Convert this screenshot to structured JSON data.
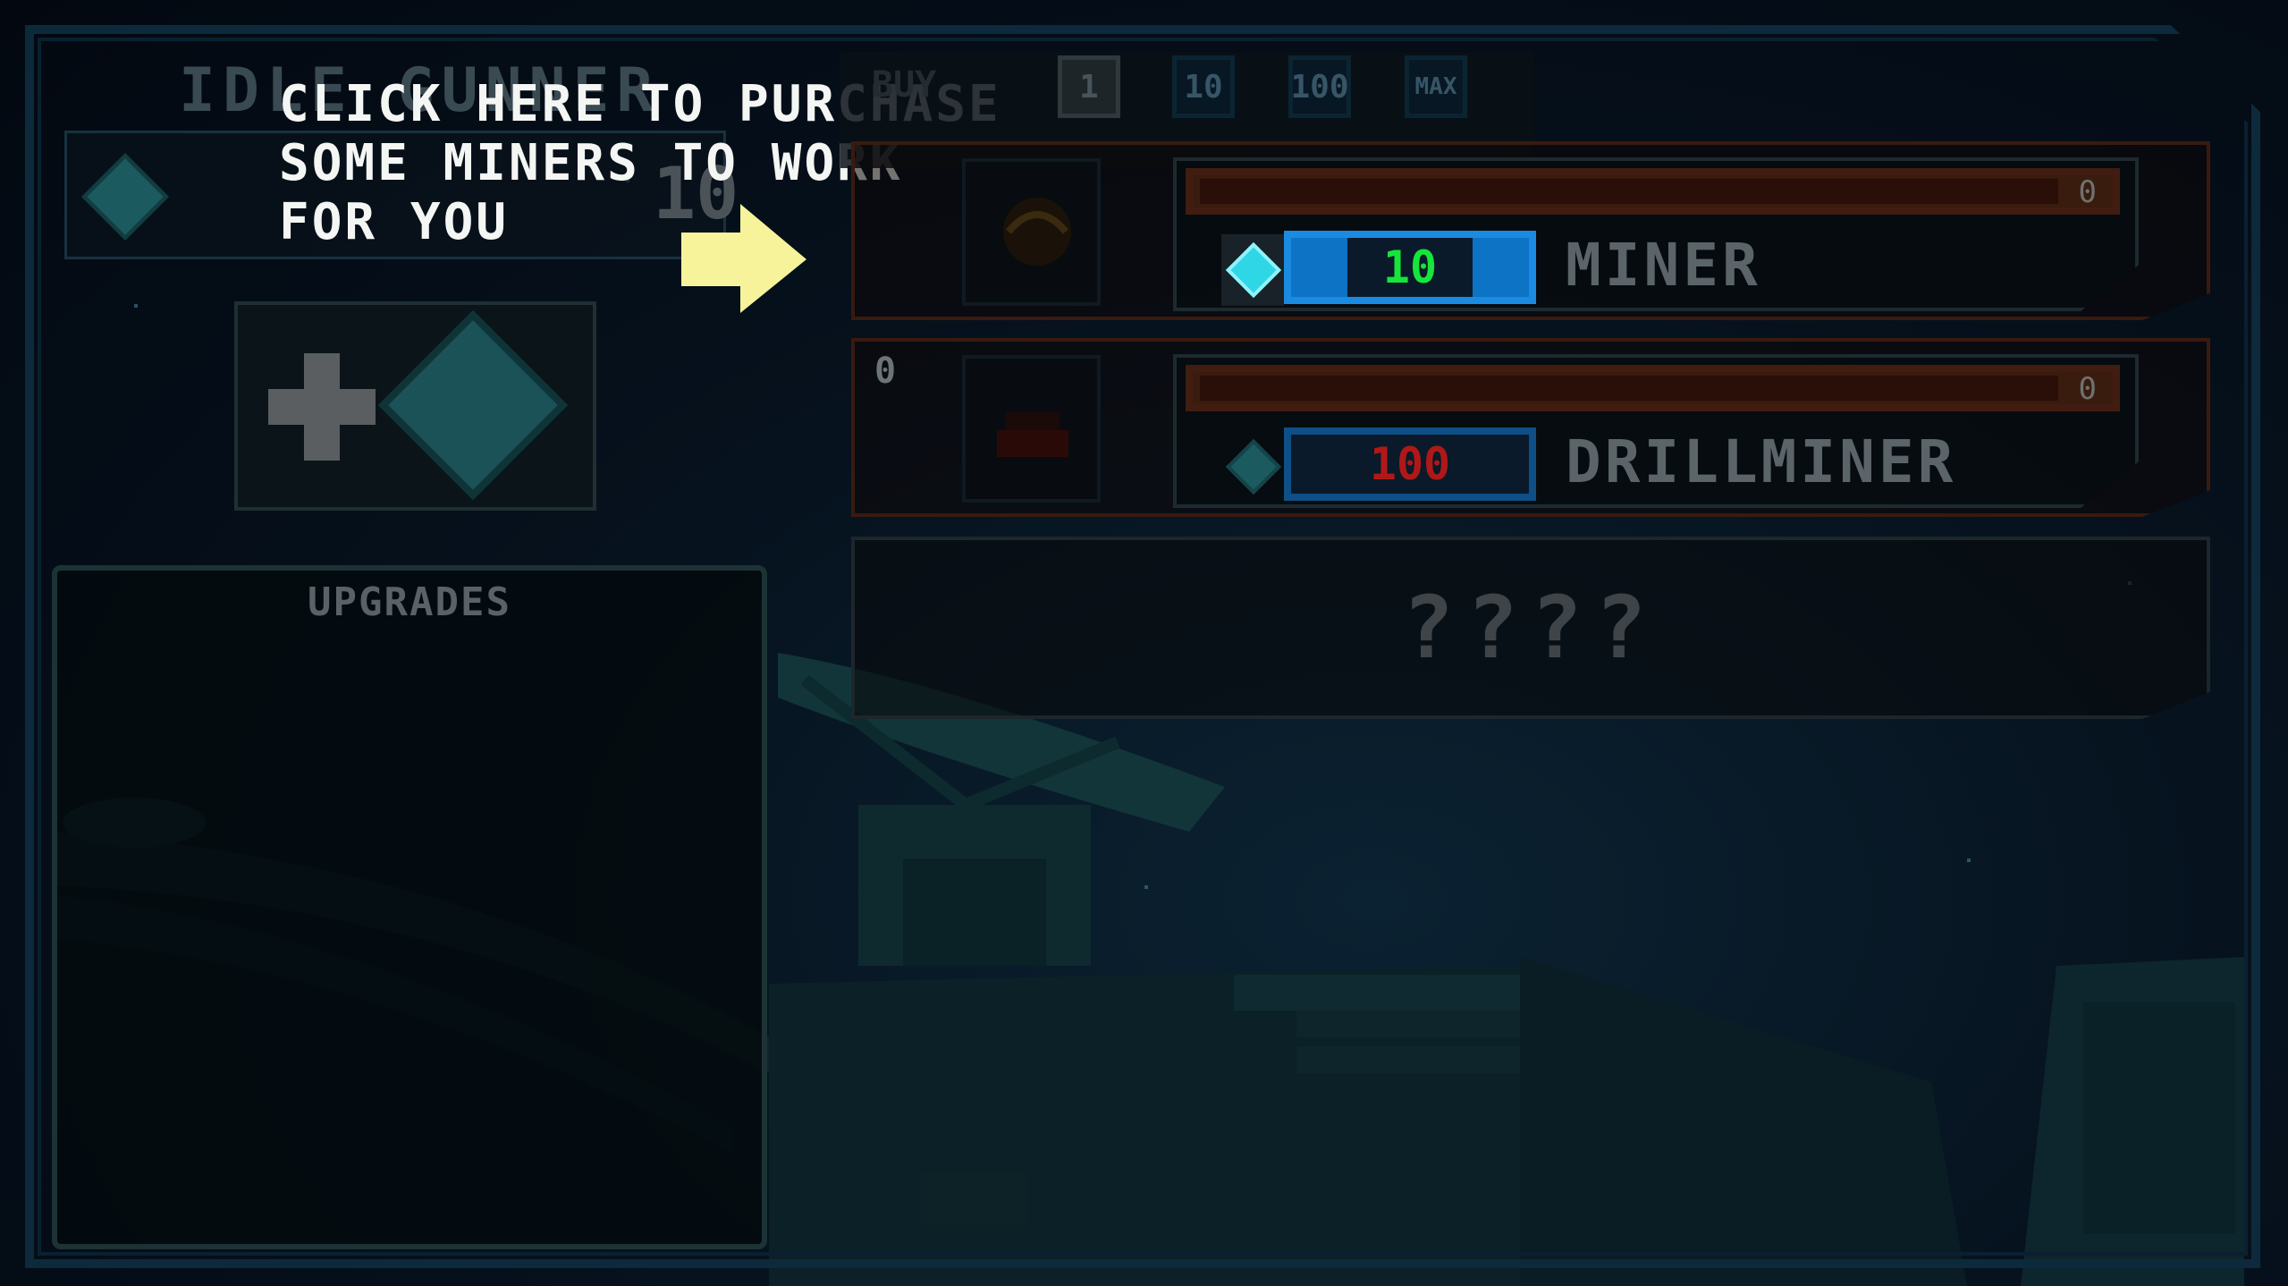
{
  "title": "IDLE GUNNER",
  "currency": {
    "gem_icon": "gem-icon",
    "amount": "10"
  },
  "tutorial": {
    "lines": [
      "CLICK HERE TO PURCHASE",
      "SOME MINERS TO WORK",
      "FOR YOU"
    ]
  },
  "add_button": {
    "plus_icon": "plus-icon",
    "gem_icon": "gem-icon"
  },
  "upgrades": {
    "title": "UPGRADES"
  },
  "buy_bar": {
    "label": "BUY",
    "options": [
      "1",
      "10",
      "100",
      "MAX"
    ],
    "selected": "1"
  },
  "miners": [
    {
      "name": "MINER",
      "owned": "",
      "progress_value": "0",
      "price": "10",
      "affordable": true,
      "price_color": "#16e53a"
    },
    {
      "name": "DRILLMINER",
      "owned": "0",
      "progress_value": "0",
      "price": "100",
      "affordable": false,
      "price_color": "#b01818"
    }
  ],
  "locked_slot": {
    "label": "????"
  },
  "colors": {
    "accent_gem": "#2fd6e6",
    "price_border": "#0e4f87",
    "row_border": "#3a1a0e",
    "arrow": "#f6f39a"
  }
}
